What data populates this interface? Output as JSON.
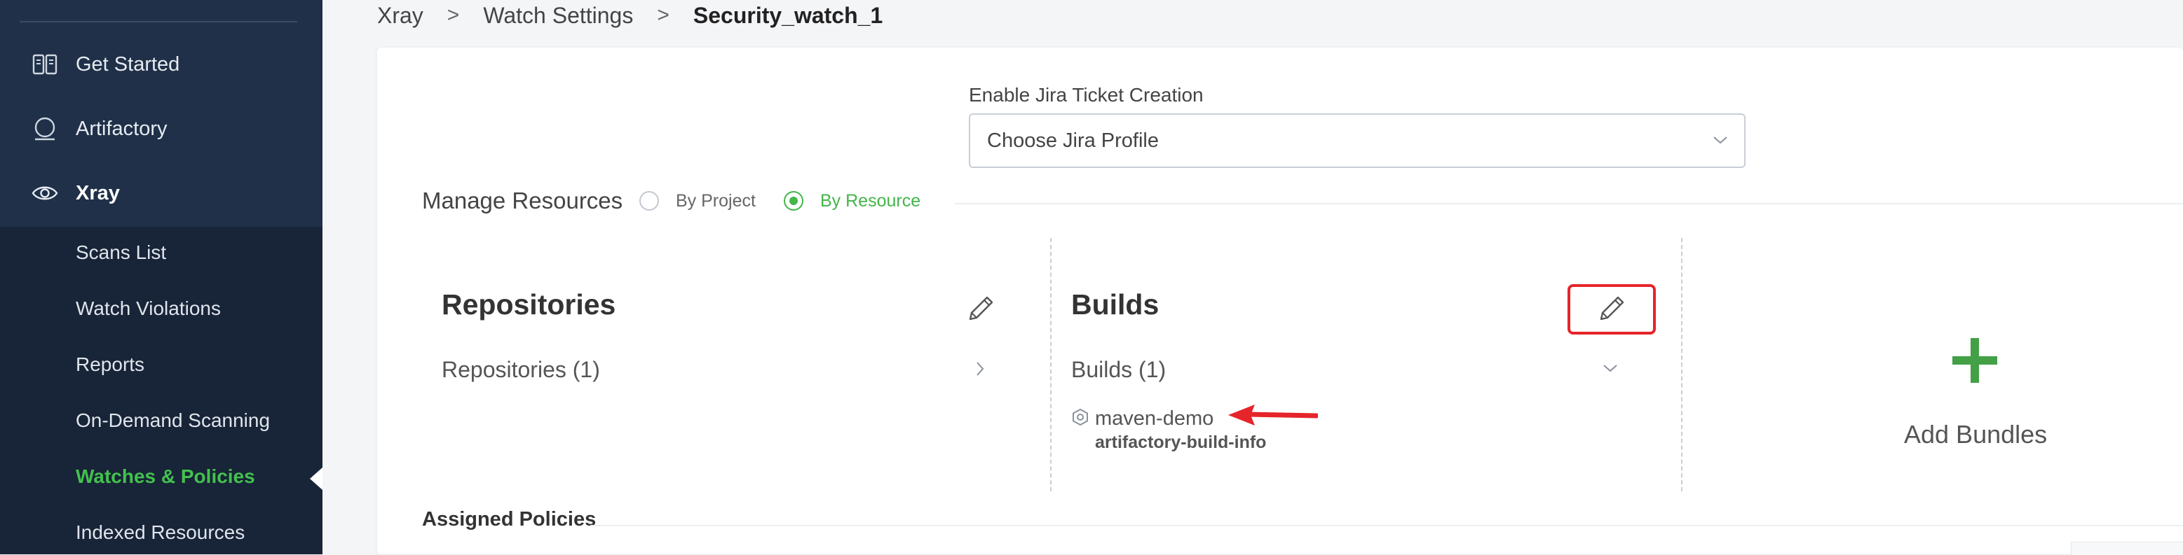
{
  "sidebar": {
    "items": [
      {
        "label": "Get Started",
        "icon": "book-icon"
      },
      {
        "label": "Artifactory",
        "icon": "artifactory-icon"
      },
      {
        "label": "Xray",
        "icon": "eye-icon"
      }
    ],
    "submenu": [
      {
        "label": "Scans List"
      },
      {
        "label": "Watch Violations"
      },
      {
        "label": "Reports"
      },
      {
        "label": "On-Demand Scanning"
      },
      {
        "label": "Watches & Policies",
        "selected": true
      },
      {
        "label": "Indexed Resources"
      }
    ]
  },
  "breadcrumb": {
    "items": [
      "Xray",
      "Watch Settings"
    ],
    "current": "Security_watch_1"
  },
  "jira": {
    "label": "Enable Jira Ticket Creation",
    "placeholder": "Choose Jira Profile"
  },
  "manage": {
    "label": "Manage Resources",
    "options": [
      "By Project",
      "By Resource"
    ],
    "selected": "By Resource"
  },
  "repositories": {
    "title": "Repositories",
    "count_label": "Repositories (1)"
  },
  "builds": {
    "title": "Builds",
    "count_label": "Builds (1)",
    "items": [
      {
        "name": "maven-demo",
        "sub": "artifactory-build-info"
      }
    ]
  },
  "bundles": {
    "add_label": "Add Bundles"
  },
  "policies": {
    "label": "Assigned Policies"
  },
  "colors": {
    "sidebar_bg": "#1f3048",
    "submenu_bg": "#182437",
    "accent_green": "#43c14f",
    "highlight_red": "#e5252a"
  }
}
